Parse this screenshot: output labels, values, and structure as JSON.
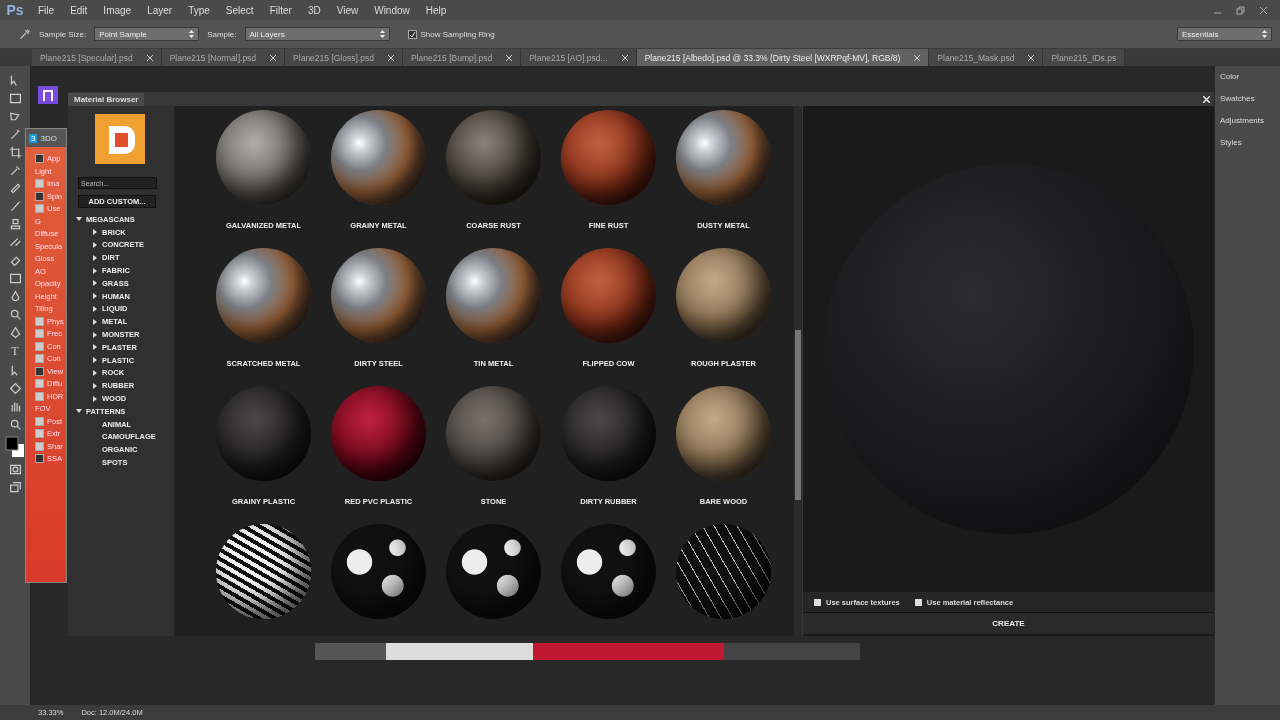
{
  "app_logo": "Ps",
  "menu": [
    "File",
    "Edit",
    "Image",
    "Layer",
    "Type",
    "Select",
    "Filter",
    "3D",
    "View",
    "Window",
    "Help"
  ],
  "options_bar": {
    "sample_size_label": "Sample Size:",
    "sample_size": "Point Sample",
    "sample_label": "Sample:",
    "sample": "All Layers",
    "sampling_ring": {
      "label": "Show Sampling Ring",
      "checked": true
    },
    "workspace": "Essentials"
  },
  "document_tabs": [
    {
      "label": "Plane215 [Specular].psd",
      "selected": false
    },
    {
      "label": "Plane215 [Normal].psd",
      "selected": false
    },
    {
      "label": "Plane215 [Gloss].psd",
      "selected": false
    },
    {
      "label": "Plane215 [Bump].psd",
      "selected": false
    },
    {
      "label": "Plane215 [AO].psd...",
      "selected": false
    },
    {
      "label": "Plane215 [Albedo].psd @ 33.3% (Dirty Steel [WXRPqf-MV], RGB/8)",
      "selected": true
    },
    {
      "label": "Plane215_Mask.psd",
      "selected": false
    },
    {
      "label": "Plane215_IDs.ps",
      "selected": false
    }
  ],
  "tools_text_tool": "T",
  "right_panels": [
    "Color",
    "Swatches",
    "Adjustments",
    "Styles"
  ],
  "side_panel": {
    "logo_letter": "3",
    "title": "3DO",
    "rows": [
      {
        "kind": "checkbox",
        "text": "App",
        "checked": true
      },
      {
        "kind": "label",
        "text": "Light"
      },
      {
        "kind": "checkbox",
        "text": "Ima",
        "checked": false
      },
      {
        "kind": "checkbox",
        "text": "Spin",
        "checked": true
      },
      {
        "kind": "checkbox",
        "text": "Use",
        "checked": false
      },
      {
        "kind": "label",
        "text": "G"
      },
      {
        "kind": "label",
        "text": "Diffuse"
      },
      {
        "kind": "label",
        "text": "Specula"
      },
      {
        "kind": "label",
        "text": "Gloss"
      },
      {
        "kind": "label",
        "text": "AO"
      },
      {
        "kind": "label",
        "text": "Opacity"
      },
      {
        "kind": "label",
        "text": "Height"
      },
      {
        "kind": "label",
        "text": "Tiling"
      },
      {
        "kind": "checkbox",
        "text": "Phys",
        "checked": false
      },
      {
        "kind": "checkbox",
        "text": "Frec",
        "checked": false
      },
      {
        "kind": "checkbox",
        "text": "Con",
        "checked": false
      },
      {
        "kind": "checkbox",
        "text": "Con",
        "checked": false
      },
      {
        "kind": "checkbox",
        "text": "View",
        "checked": true
      },
      {
        "kind": "checkbox",
        "text": "Diffu",
        "checked": false
      },
      {
        "kind": "checkbox",
        "text": "HDR",
        "checked": false
      },
      {
        "kind": "label",
        "text": "FOV"
      },
      {
        "kind": "checkbox",
        "text": "Post",
        "checked": false
      },
      {
        "kind": "checkbox",
        "text": "Extr",
        "checked": false
      },
      {
        "kind": "checkbox",
        "text": "Shar",
        "checked": false
      },
      {
        "kind": "checkbox",
        "text": "SSA",
        "checked": true
      }
    ]
  },
  "material_browser": {
    "title": "Material Browser",
    "search": {
      "placeholder": "Search..."
    },
    "add_button": "ADD CUSTOM...",
    "tree": [
      {
        "label": "MEGASCANS",
        "expanded": true,
        "children": [
          {
            "label": "BRICK",
            "expanded": false
          },
          {
            "label": "CONCRETE",
            "expanded": false
          },
          {
            "label": "DIRT",
            "expanded": false
          },
          {
            "label": "FABRIC",
            "expanded": false
          },
          {
            "label": "GRASS",
            "expanded": false
          },
          {
            "label": "HUMAN",
            "expanded": false
          },
          {
            "label": "LIQUID",
            "expanded": false
          },
          {
            "label": "METAL",
            "expanded": false
          },
          {
            "label": "MONSTER",
            "expanded": false
          },
          {
            "label": "PLASTER",
            "expanded": false
          },
          {
            "label": "PLASTIC",
            "expanded": false
          },
          {
            "label": "ROCK",
            "expanded": false
          },
          {
            "label": "RUBBER",
            "expanded": false
          },
          {
            "label": "WOOD",
            "expanded": false
          }
        ]
      },
      {
        "label": "PATTERNS",
        "expanded": true,
        "children": [
          {
            "label": "ANIMAL"
          },
          {
            "label": "CAMOUFLAGE"
          },
          {
            "label": "ORGANIC"
          },
          {
            "label": "SPOTS"
          }
        ]
      }
    ],
    "materials": [
      {
        "name": "GALVANIZED METAL",
        "kind": "matte"
      },
      {
        "name": "GRAINY METAL",
        "kind": "shiny"
      },
      {
        "name": "COARSE RUST",
        "kind": "rough"
      },
      {
        "name": "FINE RUST",
        "kind": "rust"
      },
      {
        "name": "DUSTY METAL",
        "kind": "shiny"
      },
      {
        "name": "SCRATCHED METAL",
        "kind": "shiny"
      },
      {
        "name": "DIRTY STEEL",
        "kind": "shiny"
      },
      {
        "name": "TIN METAL",
        "kind": "shiny"
      },
      {
        "name": "FLIPPED COW",
        "kind": "rust"
      },
      {
        "name": "ROUGH PLASTER",
        "kind": "plaster"
      },
      {
        "name": "GRAINY PLASTIC",
        "kind": "black"
      },
      {
        "name": "RED PVC PLASTIC",
        "kind": "red"
      },
      {
        "name": "STONE",
        "kind": "stone"
      },
      {
        "name": "DIRTY RUBBER",
        "kind": "black"
      },
      {
        "name": "BARE WOOD",
        "kind": "plaster"
      },
      {
        "kind": "stripes"
      },
      {
        "kind": "spots"
      },
      {
        "kind": "spots"
      },
      {
        "kind": "spots"
      },
      {
        "kind": "cracks"
      }
    ],
    "options": [
      {
        "label": "Use surface textures",
        "checked": false
      },
      {
        "label": "Use material reflectance",
        "checked": false
      }
    ],
    "create_button": "CREATE"
  },
  "status_bar": {
    "zoom": "33.33%",
    "doc": "Doc: 12.0M/24.0M"
  }
}
